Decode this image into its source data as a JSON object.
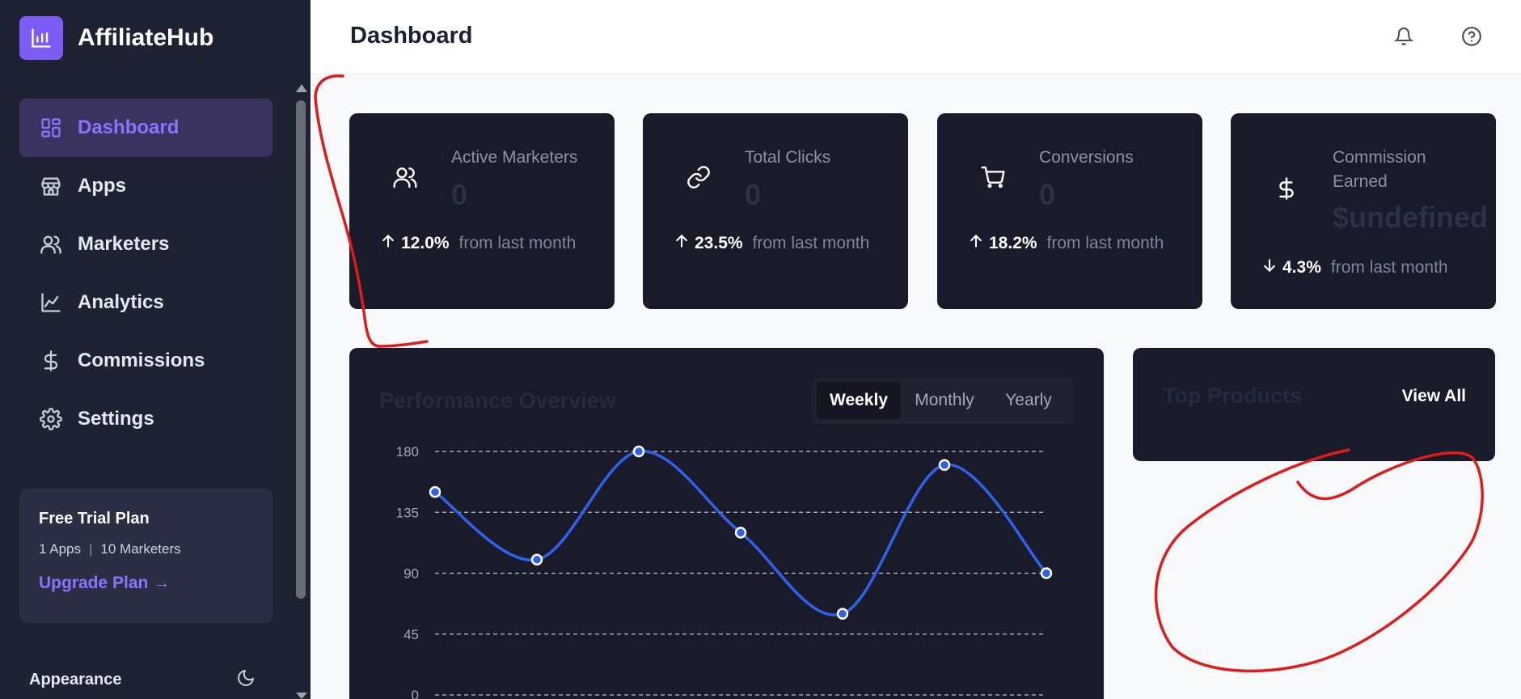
{
  "brand": {
    "name": "AffiliateHub",
    "logo_icon": "bar-chart-icon",
    "accent": "#7c5cf5"
  },
  "sidebar": {
    "items": [
      {
        "label": "Dashboard",
        "icon": "grid-icon",
        "active": true
      },
      {
        "label": "Apps",
        "icon": "store-icon",
        "active": false
      },
      {
        "label": "Marketers",
        "icon": "users-icon",
        "active": false
      },
      {
        "label": "Analytics",
        "icon": "line-chart-icon",
        "active": false
      },
      {
        "label": "Commissions",
        "icon": "dollar-icon",
        "active": false
      },
      {
        "label": "Settings",
        "icon": "gear-icon",
        "active": false
      }
    ],
    "plan": {
      "title": "Free Trial Plan",
      "apps": "1 Apps",
      "separator": "|",
      "marketers": "10 Marketers",
      "upgrade": "Upgrade Plan →"
    },
    "appearance": {
      "label": "Appearance",
      "icon": "moon-icon"
    }
  },
  "header": {
    "title": "Dashboard",
    "icons": [
      "bell-icon",
      "help-icon"
    ]
  },
  "stats": [
    {
      "label": "Active Marketers",
      "value": "0",
      "trend_dir": "up",
      "pct": "12.0%",
      "from": "from last month",
      "icon": "users-icon"
    },
    {
      "label": "Total Clicks",
      "value": "0",
      "trend_dir": "up",
      "pct": "23.5%",
      "from": "from last month",
      "icon": "link-icon"
    },
    {
      "label": "Conversions",
      "value": "0",
      "trend_dir": "up",
      "pct": "18.2%",
      "from": "from last month",
      "icon": "cart-icon"
    },
    {
      "label": "Commission Earned",
      "value": "$undefined",
      "trend_dir": "down",
      "pct": "4.3%",
      "from": "from last month",
      "icon": "dollar-icon"
    }
  ],
  "performance": {
    "title": "Performance Overview",
    "tabs": [
      "Weekly",
      "Monthly",
      "Yearly"
    ],
    "active_tab": "Weekly"
  },
  "top_products": {
    "title": "Top Products",
    "view_all": "View All"
  },
  "chart_data": {
    "type": "line",
    "ylim": [
      0,
      180
    ],
    "yticks": [
      0,
      45,
      90,
      135,
      180
    ],
    "x": [
      1,
      2,
      3,
      4,
      5,
      6,
      7
    ],
    "series": [
      {
        "values": [
          150,
          100,
          180,
          120,
          60,
          170,
          90
        ]
      }
    ],
    "grid": true,
    "line_color": "#2f62ea"
  }
}
